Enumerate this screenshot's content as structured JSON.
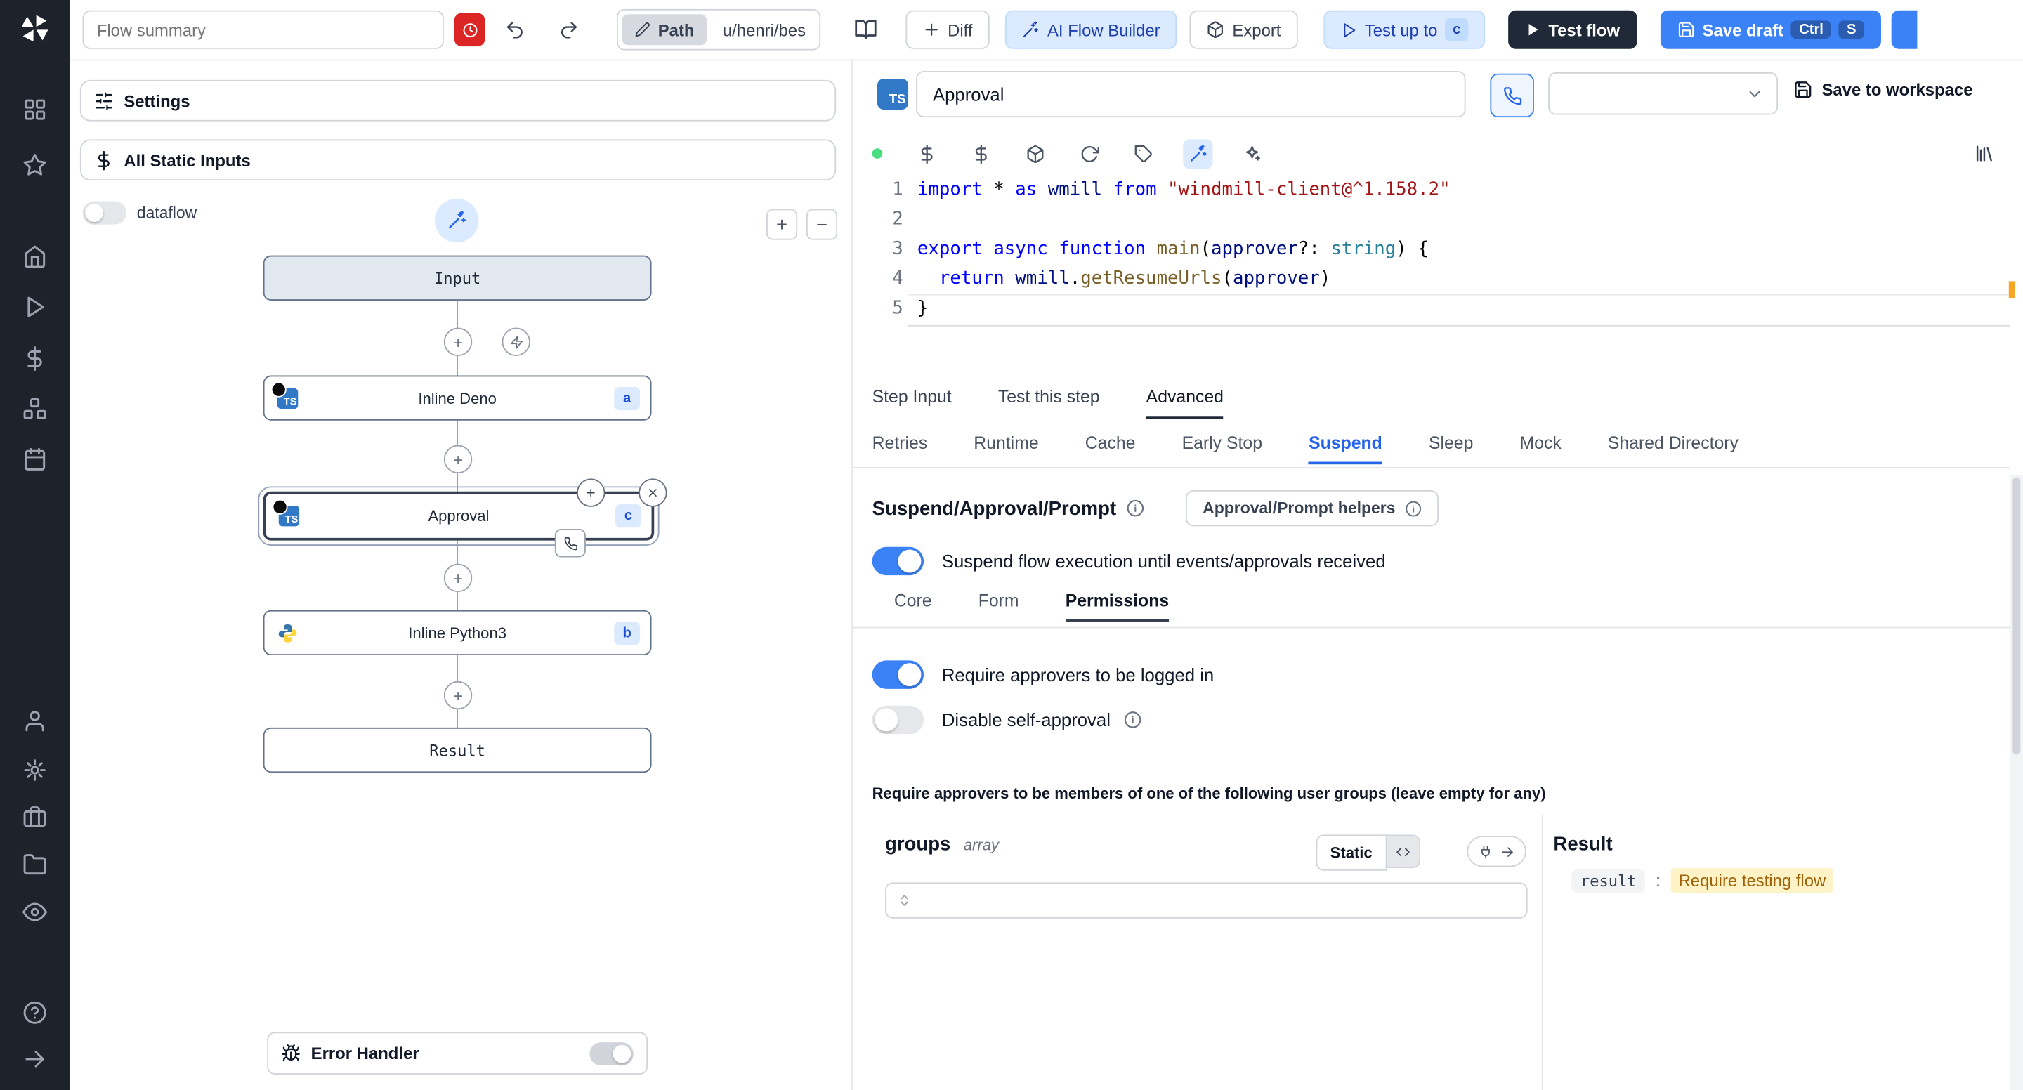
{
  "topbar": {
    "flow_summary_placeholder": "Flow summary",
    "path_label": "Path",
    "path_value": "u/henri/bes",
    "diff_label": "Diff",
    "ai_builder_label": "AI Flow Builder",
    "export_label": "Export",
    "test_up_to_label": "Test up to",
    "test_up_to_badge": "c",
    "test_flow_label": "Test flow",
    "save_draft_label": "Save draft",
    "kbd_ctrl": "Ctrl",
    "kbd_s": "S"
  },
  "flow_panel": {
    "settings_label": "Settings",
    "static_inputs_label": "All Static Inputs",
    "dataflow_label": "dataflow",
    "nodes": {
      "input": "Input",
      "deno": {
        "label": "Inline Deno",
        "badge": "a"
      },
      "approval": {
        "label": "Approval",
        "badge": "c"
      },
      "python": {
        "label": "Inline Python3",
        "badge": "b"
      },
      "result": "Result"
    },
    "error_handler_label": "Error Handler"
  },
  "editor": {
    "step_name": "Approval",
    "save_to_workspace_label": "Save to workspace",
    "code": [
      {
        "num": "1",
        "segs": [
          {
            "t": "import",
            "c": "k"
          },
          {
            "t": " * ",
            "c": "p"
          },
          {
            "t": "as",
            "c": "k"
          },
          {
            "t": " wmill ",
            "c": "v"
          },
          {
            "t": "from",
            "c": "k"
          },
          {
            "t": " ",
            "c": "p"
          },
          {
            "t": "\"windmill-client@^1.158.2\"",
            "c": "s"
          }
        ]
      },
      {
        "num": "2",
        "segs": [
          {
            "t": "",
            "c": "p"
          }
        ]
      },
      {
        "num": "3",
        "segs": [
          {
            "t": "export",
            "c": "k"
          },
          {
            "t": " ",
            "c": "p"
          },
          {
            "t": "async",
            "c": "k"
          },
          {
            "t": " ",
            "c": "p"
          },
          {
            "t": "function",
            "c": "k"
          },
          {
            "t": " ",
            "c": "p"
          },
          {
            "t": "main",
            "c": "f"
          },
          {
            "t": "(",
            "c": "p"
          },
          {
            "t": "approver",
            "c": "v"
          },
          {
            "t": "?: ",
            "c": "p"
          },
          {
            "t": "string",
            "c": "t"
          },
          {
            "t": ") {",
            "c": "p"
          }
        ]
      },
      {
        "num": "4",
        "segs": [
          {
            "t": "  ",
            "c": "p"
          },
          {
            "t": "return",
            "c": "k"
          },
          {
            "t": " ",
            "c": "p"
          },
          {
            "t": "wmill",
            "c": "v"
          },
          {
            "t": ".",
            "c": "p"
          },
          {
            "t": "getResumeUrls",
            "c": "f"
          },
          {
            "t": "(",
            "c": "p"
          },
          {
            "t": "approver",
            "c": "v"
          },
          {
            "t": ")",
            "c": "p"
          }
        ]
      },
      {
        "num": "5",
        "segs": [
          {
            "t": "}",
            "c": "p"
          }
        ]
      }
    ]
  },
  "tabs": {
    "step": [
      "Step Input",
      "Test this step",
      "Advanced"
    ],
    "advanced": [
      "Retries",
      "Runtime",
      "Cache",
      "Early Stop",
      "Suspend",
      "Sleep",
      "Mock",
      "Shared Directory"
    ]
  },
  "suspend": {
    "title": "Suspend/Approval/Prompt",
    "helpers_button": "Approval/Prompt helpers",
    "toggle_suspend": "Suspend flow execution until events/approvals received",
    "subtabs": [
      "Core",
      "Form",
      "Permissions"
    ],
    "toggle_login": "Require approvers to be logged in",
    "toggle_self": "Disable self-approval",
    "groups_note": "Require approvers to be members of one of the following user groups (leave empty for any)",
    "groups_label": "groups",
    "groups_type": "array",
    "static_button": "Static",
    "result_title": "Result",
    "result_key": "result",
    "result_value": "Require testing flow"
  },
  "colors": {
    "accent_blue": "#3b82f6",
    "soft_blue": "#dbeafe",
    "dark_button": "#1f2937",
    "danger_red": "#dc2626",
    "highlight_yellow": "#fef3c7"
  }
}
